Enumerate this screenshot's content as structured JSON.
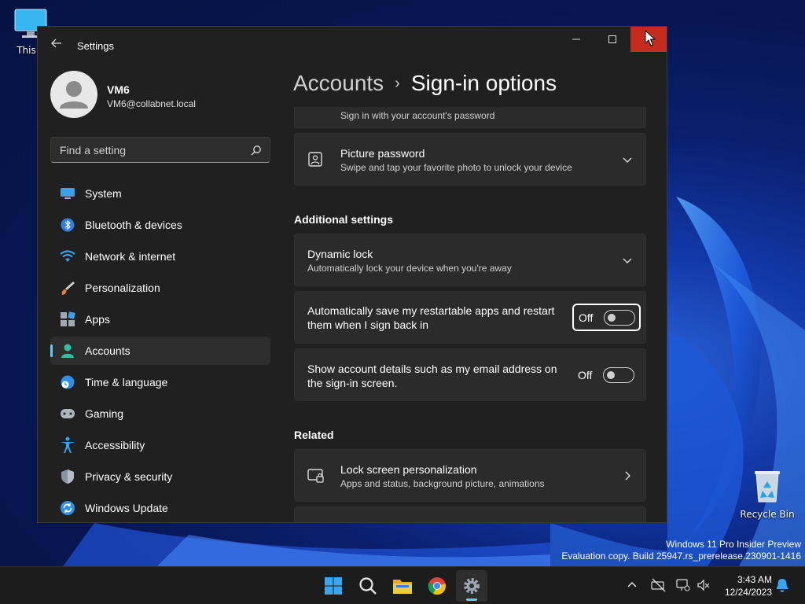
{
  "desktop": {
    "icons": [
      {
        "label": "This P"
      },
      {
        "label": "Recycle Bin"
      }
    ],
    "watermark": {
      "line1": "Windows 11 Pro Insider Preview",
      "line2": "Evaluation copy. Build 25947.rs_prerelease.230901-1416"
    }
  },
  "window": {
    "title": "Settings",
    "user": {
      "name": "VM6",
      "email": "VM6@collabnet.local"
    },
    "search": {
      "placeholder": "Find a setting"
    },
    "nav": [
      {
        "label": "System",
        "icon": "monitor-icon"
      },
      {
        "label": "Bluetooth & devices",
        "icon": "bluetooth-icon"
      },
      {
        "label": "Network & internet",
        "icon": "wifi-icon"
      },
      {
        "label": "Personalization",
        "icon": "brush-icon"
      },
      {
        "label": "Apps",
        "icon": "apps-icon"
      },
      {
        "label": "Accounts",
        "icon": "person-icon",
        "active": true
      },
      {
        "label": "Time & language",
        "icon": "globe-clock-icon"
      },
      {
        "label": "Gaming",
        "icon": "gamepad-icon"
      },
      {
        "label": "Accessibility",
        "icon": "accessibility-icon"
      },
      {
        "label": "Privacy & security",
        "icon": "shield-icon"
      },
      {
        "label": "Windows Update",
        "icon": "update-icon"
      }
    ],
    "breadcrumb": {
      "parent": "Accounts",
      "separator": "›",
      "current": "Sign-in options"
    },
    "content": {
      "password_card": {
        "subtitle": "Sign in with your account's password"
      },
      "picture_password": {
        "title": "Picture password",
        "subtitle": "Swipe and tap your favorite photo to unlock your device"
      },
      "additional_header": "Additional settings",
      "dynamic_lock": {
        "title": "Dynamic lock",
        "subtitle": "Automatically lock your device when you're away"
      },
      "restart_apps": {
        "line1": "Automatically save my restartable apps and restart",
        "line2": "them when I sign back in",
        "state": "Off"
      },
      "account_details": {
        "line1": "Show account details such as my email address on",
        "line2": "the sign-in screen.",
        "state": "Off"
      },
      "related_header": "Related",
      "lock_screen": {
        "title": "Lock screen personalization",
        "subtitle": "Apps and status, background picture, animations"
      }
    }
  },
  "taskbar": {
    "apps": [
      "start-icon",
      "search-icon",
      "file-explorer-icon",
      "chrome-icon",
      "settings-icon"
    ],
    "clock": {
      "time": "3:43 AM",
      "date": "12/24/2023"
    }
  },
  "colors": {
    "accent": "#60cdff",
    "close": "#c42b1c",
    "window_bg": "#202020",
    "card_bg": "#2b2b2b"
  }
}
